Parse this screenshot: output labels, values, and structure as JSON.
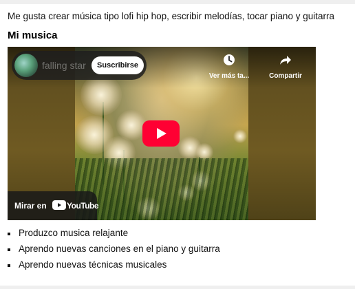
{
  "intro_text": "Me gusta crear música tipo lofi hip hop, escribir melodías, tocar piano y guitarra",
  "section_title": "Mi musica",
  "video": {
    "title": "falling star",
    "subscribe_label": "Suscribirse",
    "watch_later_label": "Ver más ta...",
    "share_label": "Compartir",
    "watch_on_label": "Mirar en",
    "youtube_wordmark": "YouTube",
    "play_color": "#ff0033"
  },
  "features": [
    "Produzco musica relajante",
    "Aprendo nuevas canciones en el piano y guitarra",
    "Aprendo nuevas técnicas musicales"
  ]
}
